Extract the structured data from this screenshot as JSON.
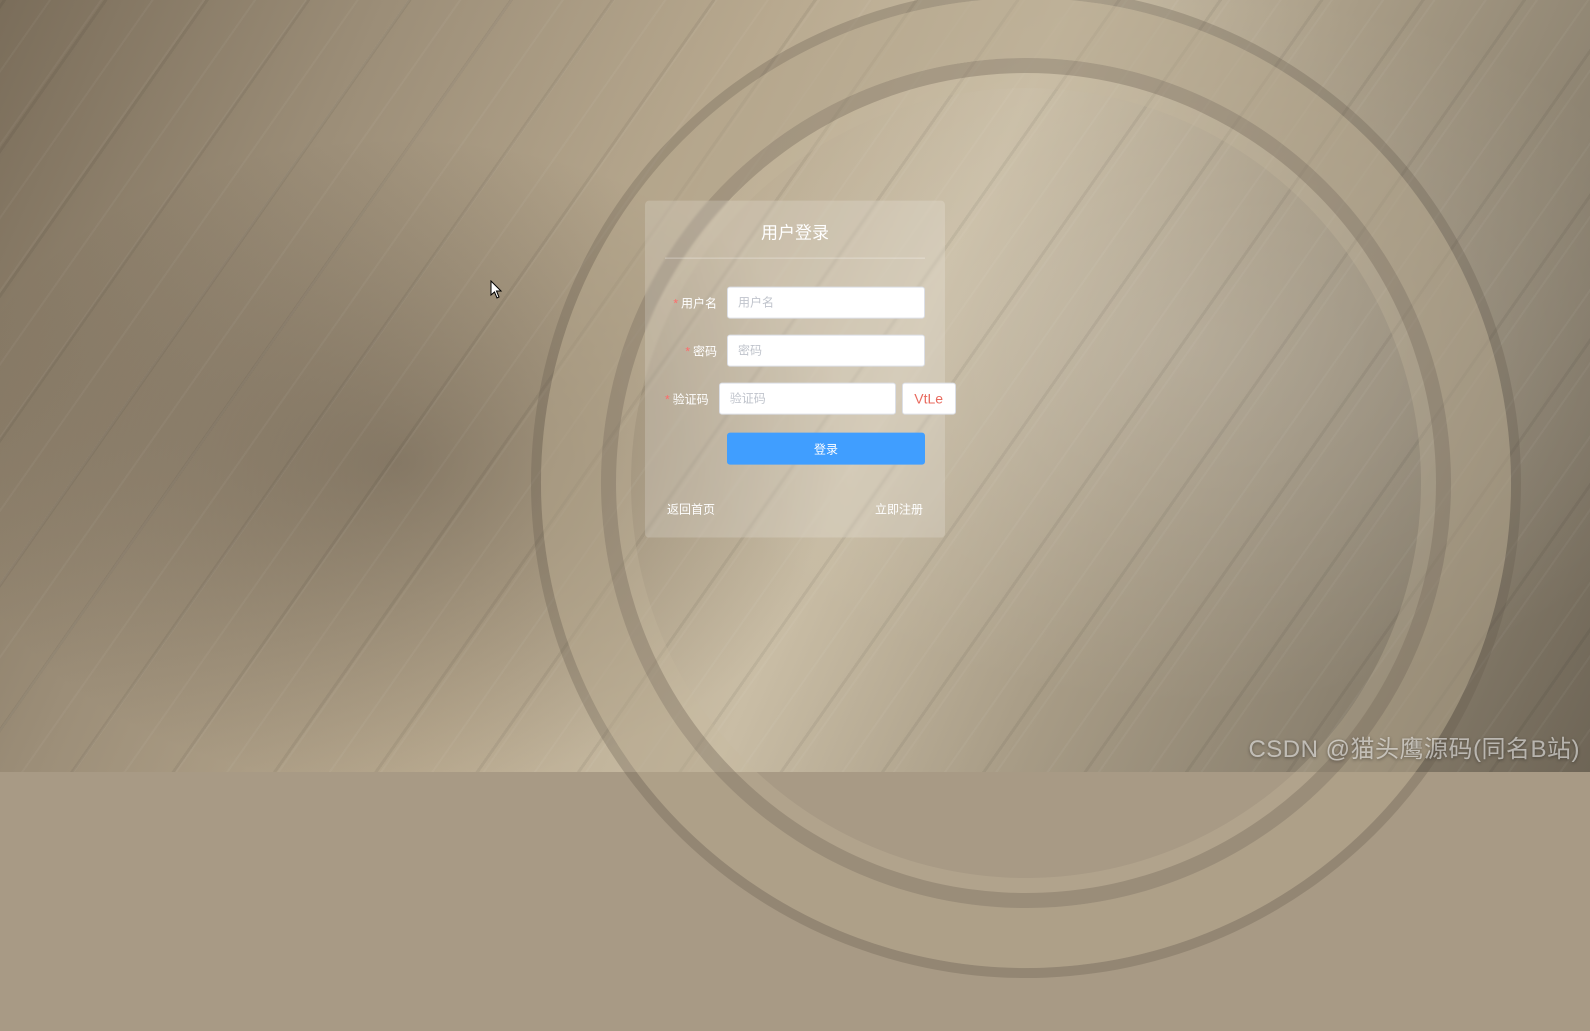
{
  "panel": {
    "title": "用户登录"
  },
  "form": {
    "username": {
      "label": "用户名",
      "placeholder": "用户名",
      "value": ""
    },
    "password": {
      "label": "密码",
      "placeholder": "密码",
      "value": ""
    },
    "captcha": {
      "label": "验证码",
      "placeholder": "验证码",
      "value": "",
      "code": "VtLe"
    }
  },
  "buttons": {
    "login": "登录"
  },
  "links": {
    "back_home": "返回首页",
    "register": "立即注册"
  },
  "watermark": "CSDN @猫头鹰源码(同名B站)"
}
